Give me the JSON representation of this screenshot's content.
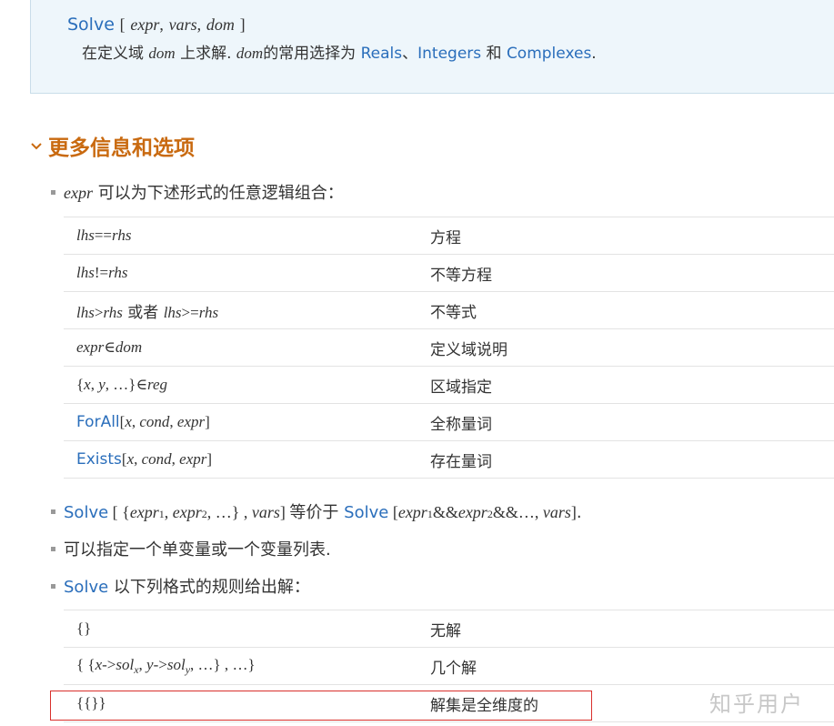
{
  "usage": {
    "fn": "Solve",
    "lb": "[",
    "arg1": "expr",
    "arg2": "vars",
    "arg3": "dom",
    "rb": "]",
    "desc_pre": "在定义域",
    "desc_dom1": "dom",
    "desc_mid1": "上求解.",
    "desc_dom2": "dom",
    "desc_mid2": "的常用选择为",
    "opt1": "Reals",
    "sep1": "、",
    "opt2": "Integers",
    "sep2": "和",
    "opt3": "Complexes",
    "end": "."
  },
  "section": {
    "title": "更多信息和选项",
    "chevron_icon": "chevron-down-icon"
  },
  "bullet1": {
    "expr": "expr",
    "text": "可以为下述形式的任意逻辑组合："
  },
  "forms": [
    {
      "lhs_a": "lhs",
      "op": "==",
      "rhs_a": "rhs",
      "desc": "方程"
    },
    {
      "lhs_a": "lhs",
      "op": "!=",
      "rhs_a": "rhs",
      "desc": "不等方程"
    },
    {
      "lhs_a": "lhs",
      "op": ">",
      "rhs_a": "rhs",
      "or": "或者",
      "lhs_b": "lhs",
      "op2": ">=",
      "rhs_b": "rhs",
      "desc": "不等式"
    },
    {
      "lhs_a": "expr",
      "op": "∈",
      "rhs_a": "dom",
      "desc": "定义域说明"
    },
    {
      "set": "{",
      "x": "x",
      "y": "y",
      "dots": "…",
      "close": "}",
      "op": "∈",
      "reg": "reg",
      "desc": "区域指定"
    },
    {
      "fn": "ForAll",
      "x": "x",
      "cond": "cond",
      "expr": "expr",
      "desc": "全称量词"
    },
    {
      "fn": "Exists",
      "x": "x",
      "cond": "cond",
      "expr": "expr",
      "desc": "存在量词"
    }
  ],
  "bullet2": {
    "fn1": "Solve",
    "expr": "expr",
    "s1": "1",
    "s2": "2",
    "dots": "…",
    "vars": "vars",
    "mid": "等价于",
    "fn2": "Solve",
    "and": "&&",
    "end": "."
  },
  "bullet3": {
    "text": "可以指定一个单变量或一个变量列表."
  },
  "bullet4": {
    "fn": "Solve",
    "text": "以下列格式的规则给出解："
  },
  "results": [
    {
      "form": "{}",
      "desc": "无解"
    },
    {
      "x": "x",
      "sol": "sol",
      "subx": "x",
      "y": "y",
      "suby": "y",
      "dots": "…",
      "desc": "几个解"
    },
    {
      "form": "{{}}",
      "desc": "解集是全维度的"
    }
  ],
  "watermark": "知乎用户",
  "colors": {
    "link": "#2a6ebb",
    "section": "#c96a10",
    "highlight": "#d9302c",
    "usage_bg": "#eef6fb"
  }
}
